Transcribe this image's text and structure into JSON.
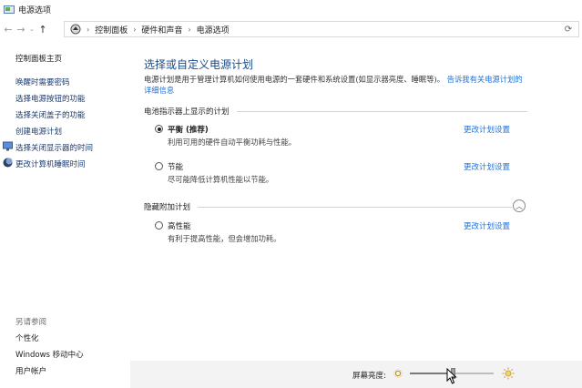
{
  "window": {
    "title": "电源选项",
    "icon": "power-options-icon"
  },
  "address": {
    "nav_back_icon": "arrow-left-icon",
    "nav_forward_icon": "arrow-right-icon",
    "nav_recent_icon": "chevron-down-icon",
    "nav_up_icon": "arrow-up-icon",
    "crumbs": [
      "控制面板",
      "硬件和声音",
      "电源选项"
    ]
  },
  "sidebar": {
    "home": "控制面板主页",
    "links": [
      "唤醒时需要密码",
      "选择电源按钮的功能",
      "选择关闭盖子的功能",
      "创建电源计划",
      "选择关闭显示器的时间",
      "更改计算机睡眠时间"
    ],
    "see_also": "另请参阅",
    "bottom_links": [
      "个性化",
      "Windows 移动中心",
      "用户帐户"
    ]
  },
  "main": {
    "title": "选择或自定义电源计划",
    "description": "电源计划是用于管理计算机如何使用电源的一套硬件和系统设置(如显示器亮度、睡眠等)。",
    "description_link": "告诉我有关电源计划的详细信息",
    "section_shown": "电池指示器上显示的计划",
    "section_hidden": "隐藏附加计划",
    "plans": [
      {
        "name": "平衡 (推荐)",
        "desc": "利用可用的硬件自动平衡功耗与性能。",
        "link": "更改计划设置",
        "selected": true
      },
      {
        "name": "节能",
        "desc": "尽可能降低计算机性能以节能。",
        "link": "更改计划设置",
        "selected": false
      },
      {
        "name": "高性能",
        "desc": "有利于提高性能，但会增加功耗。",
        "link": "更改计划设置",
        "selected": false
      }
    ]
  },
  "statusbar": {
    "brightness_label": "屏幕亮度:",
    "brightness_value": 0.52
  },
  "colors": {
    "link": "#1f6fd6",
    "title": "#1a4b8c",
    "sidebar_link": "#1a3a6e"
  }
}
